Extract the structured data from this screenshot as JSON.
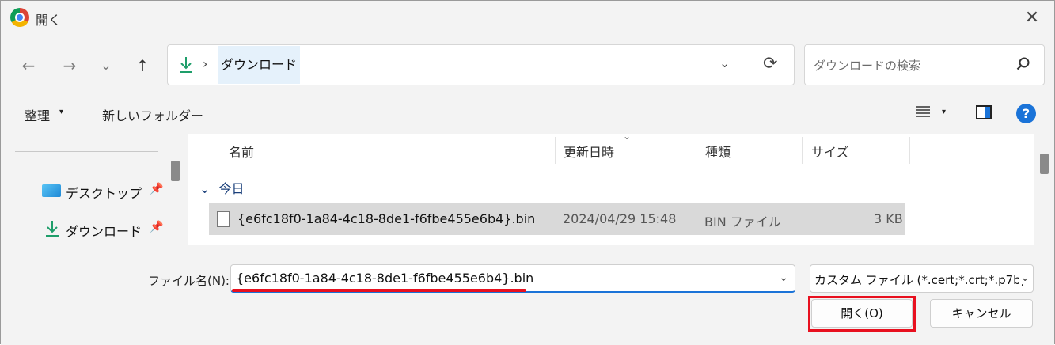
{
  "window": {
    "title": "開く",
    "close_glyph": "✕"
  },
  "nav": {
    "back_glyph": "←",
    "forward_glyph": "→",
    "recent_glyph": "⌄",
    "up_glyph": "↑",
    "breadcrumb_sep": "›",
    "current_folder": "ダウンロード",
    "dropdown_glyph": "⌄",
    "refresh_glyph": "⟳"
  },
  "search": {
    "placeholder": "ダウンロードの検索",
    "icon": "search-icon"
  },
  "toolbar": {
    "organize_label": "整理",
    "caret_glyph": "▾",
    "new_folder_label": "新しいフォルダー",
    "help_glyph": "?"
  },
  "sidebar": {
    "items": [
      {
        "label": "デスクトップ",
        "icon": "desktop-icon",
        "pin_glyph": "📌"
      },
      {
        "label": "ダウンロード",
        "icon": "download-icon",
        "pin_glyph": "📌"
      }
    ]
  },
  "file_list": {
    "columns": [
      "名前",
      "更新日時",
      "種類",
      "サイズ"
    ],
    "sort_glyph": "⌄",
    "group": {
      "chevron": "⌄",
      "label": "今日"
    },
    "rows": [
      {
        "name": "{e6fc18f0-1a84-4c18-8de1-f6fbe455e6b4}.bin",
        "modified": "2024/04/29 15:48",
        "type": "BIN ファイル",
        "size": "3 KB"
      }
    ]
  },
  "footer": {
    "filename_label": "ファイル名(N):",
    "filename_value": "{e6fc18f0-1a84-4c18-8de1-f6fbe455e6b4}.bin",
    "dropdown_glyph": "⌄",
    "filter_value": "カスタム ファイル (*.cert;*.crt;*.p7b;",
    "open_label": "開く(O)",
    "cancel_label": "キャンセル"
  },
  "colors": {
    "accent": "#1a73d8",
    "highlight": "#e8101f",
    "selection": "#d9d9d9",
    "address_segment": "#e5f1fb"
  }
}
